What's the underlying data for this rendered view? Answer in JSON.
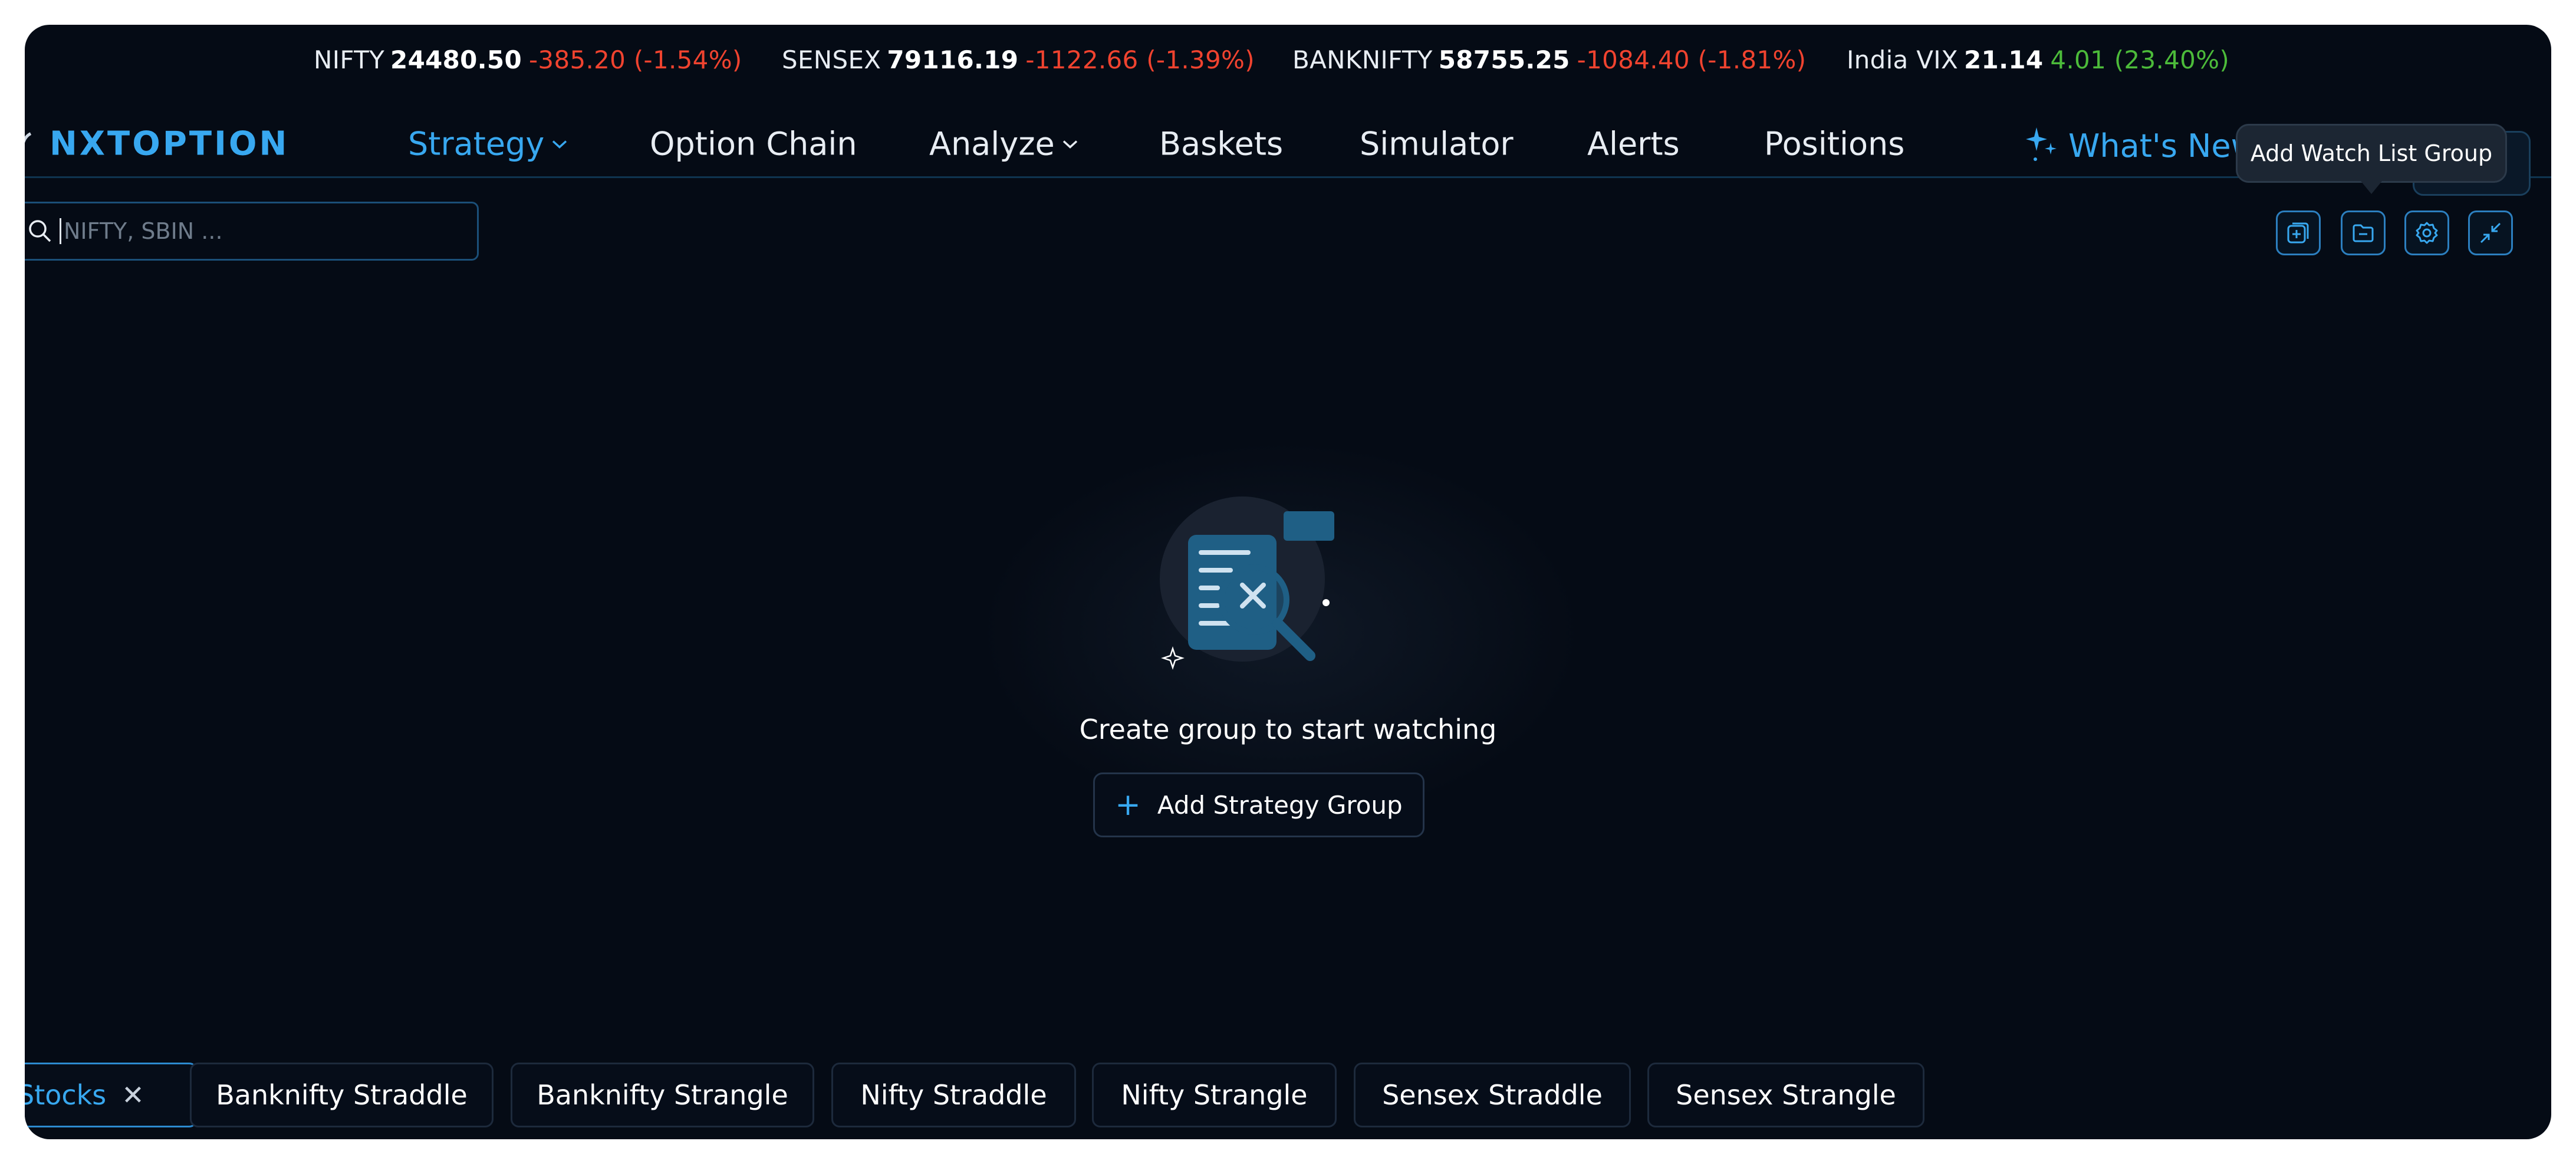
{
  "ticker": [
    {
      "name": "NIFTY",
      "price": "24480.50",
      "change": "-385.20 (-1.54%)",
      "direction": "down"
    },
    {
      "name": "SENSEX",
      "price": "79116.19",
      "change": "-1122.66 (-1.39%)",
      "direction": "down"
    },
    {
      "name": "BANKNIFTY",
      "price": "58755.25",
      "change": "-1084.40 (-1.81%)",
      "direction": "down"
    },
    {
      "name": "India VIX",
      "price": "21.14",
      "change": "4.01 (23.40%)",
      "direction": "up"
    }
  ],
  "colors": {
    "down": "#f0432f",
    "up": "#4cbb3a",
    "accent": "#38a8f0",
    "background": "#050b15"
  },
  "header": {
    "logo": "NXTOPTION",
    "nav": [
      {
        "label": "Strategy",
        "dropdown": true,
        "active": true
      },
      {
        "label": "Option Chain",
        "dropdown": false,
        "active": false
      },
      {
        "label": "Analyze",
        "dropdown": true,
        "active": false
      },
      {
        "label": "Baskets",
        "dropdown": false,
        "active": false
      },
      {
        "label": "Simulator",
        "dropdown": false,
        "active": false
      },
      {
        "label": "Alerts",
        "dropdown": false,
        "active": false
      },
      {
        "label": "Positions",
        "dropdown": false,
        "active": false
      }
    ],
    "whats_new": "What's New"
  },
  "tooltip": {
    "text": "Add Watch List Group"
  },
  "search": {
    "placeholder": "NIFTY, SBIN ..."
  },
  "toolbar": {
    "icons": [
      "add-watchlist-icon",
      "folder-icon",
      "settings-icon",
      "collapse-icon"
    ]
  },
  "empty_state": {
    "message": "Create group to start watching",
    "button_label": "Add Strategy Group"
  },
  "tabs": [
    {
      "label": "Stocks",
      "active": true,
      "closable": true
    },
    {
      "label": "Banknifty Straddle",
      "active": false
    },
    {
      "label": "Banknifty Strangle",
      "active": false
    },
    {
      "label": "Nifty Straddle",
      "active": false
    },
    {
      "label": "Nifty Strangle",
      "active": false
    },
    {
      "label": "Sensex Straddle",
      "active": false
    },
    {
      "label": "Sensex Strangle",
      "active": false
    }
  ]
}
